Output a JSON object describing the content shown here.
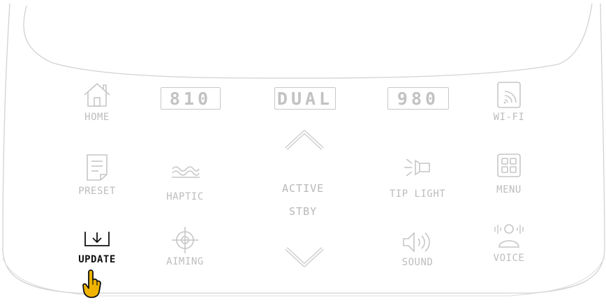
{
  "panel": {
    "displays": {
      "left": "810",
      "center": "DUAL",
      "right": "980"
    },
    "center_modes": {
      "active": "ACTIVE",
      "standby": "STBY"
    },
    "buttons": {
      "home": "HOME",
      "wifi": "WI-FI",
      "preset": "PRESET",
      "haptic": "HAPTIC",
      "tip_light": "TIP LIGHT",
      "menu": "MENU",
      "update": "UPDATE",
      "aiming": "AIMING",
      "sound": "SOUND",
      "voice": "VOICE"
    },
    "pressed_button": "UPDATE"
  },
  "colors": {
    "inactive_gray": "#bdbdbd",
    "active_black": "#111111",
    "pointer_gold": "#f0b400"
  },
  "icons": {
    "home": "home-icon",
    "wifi": "wifi-icon",
    "preset": "document-icon",
    "haptic": "waves-icon",
    "tip_light": "flashlight-icon",
    "menu": "grid-icon",
    "update": "download-icon",
    "aiming": "crosshair-icon",
    "sound": "speaker-icon",
    "voice": "voice-icon",
    "up": "chevron-up-icon",
    "down": "chevron-down-icon",
    "pointer": "hand-pointer-icon"
  }
}
